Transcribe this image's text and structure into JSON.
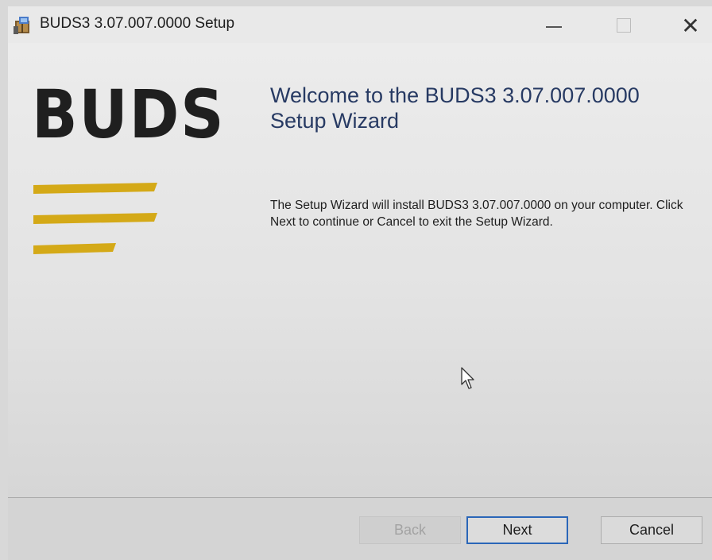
{
  "window": {
    "title": "BUDS3 3.07.007.0000 Setup",
    "close_glyph": "✕"
  },
  "logo": {
    "text": "BUDS",
    "accent_color": "#d4a917"
  },
  "welcome": {
    "title": "Welcome to the BUDS3 3.07.007.0000 Setup Wizard",
    "description": "The Setup Wizard will install BUDS3 3.07.007.0000 on your computer. Click Next to continue or Cancel to exit the Setup Wizard."
  },
  "buttons": {
    "back": "Back",
    "next": "Next",
    "cancel": "Cancel"
  }
}
